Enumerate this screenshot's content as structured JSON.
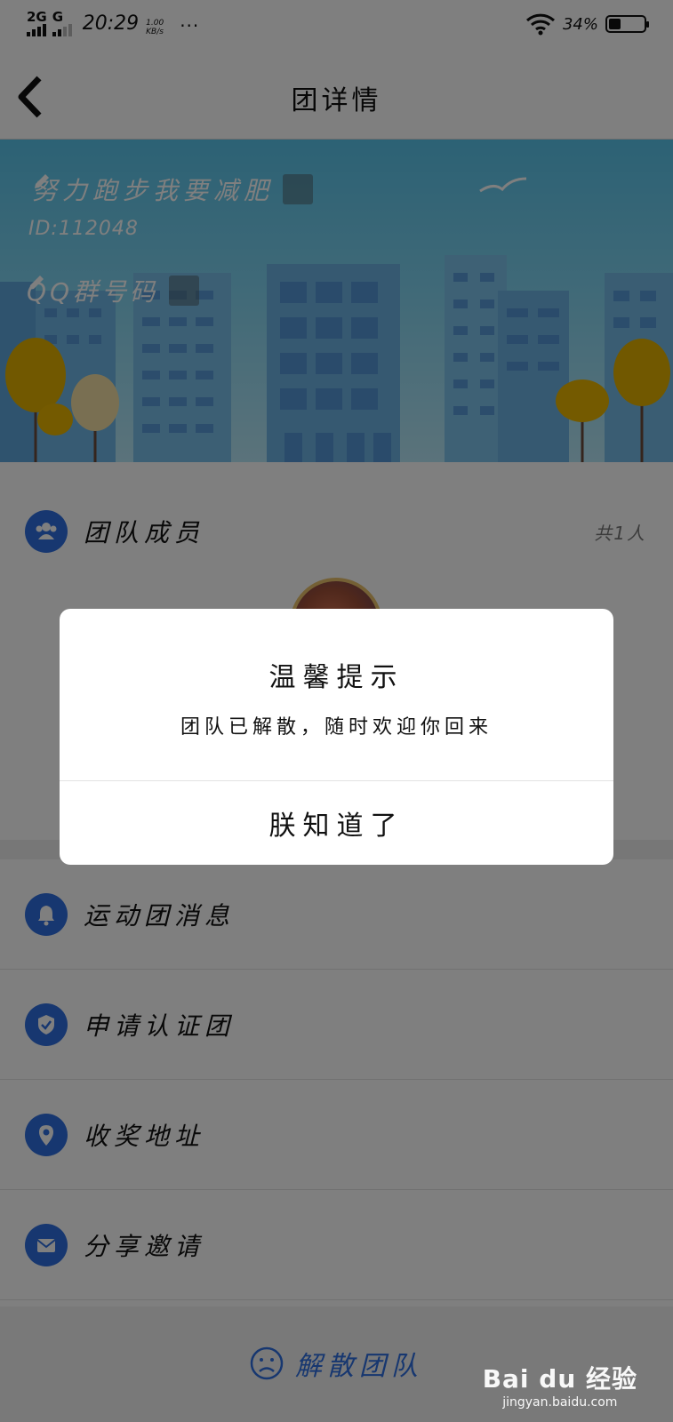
{
  "status_bar": {
    "network1": "2G",
    "network2": "G",
    "time": "20:29",
    "speed_value": "1.00",
    "speed_unit": "KB/s",
    "more": "···",
    "battery_percent": "34%",
    "battery_level": 0.34
  },
  "nav": {
    "title": "团详情",
    "back_icon": "chevron-left-icon"
  },
  "banner": {
    "team_name": "努力跑步我要减肥",
    "team_id": "ID:112048",
    "qq_label": "QQ群号码",
    "edit_icon": "pencil-icon"
  },
  "members": {
    "label": "团队成员",
    "count": "共1人",
    "icon": "group-icon"
  },
  "menu": [
    {
      "label": "运动团消息",
      "icon": "bell-icon"
    },
    {
      "label": "申请认证团",
      "icon": "shield-check-icon"
    },
    {
      "label": "收奖地址",
      "icon": "location-pin-icon"
    },
    {
      "label": "分享邀请",
      "icon": "envelope-icon"
    }
  ],
  "dissolve": {
    "label": "解散团队",
    "icon": "sad-face-icon"
  },
  "dialog": {
    "title": "温馨提示",
    "message": "团队已解散，随时欢迎你回来",
    "button": "朕知道了"
  },
  "watermark": {
    "brand": "Bai du 经验",
    "url": "jingyan.baidu.com"
  },
  "colors": {
    "accent": "#2e6fe0",
    "overlay": "rgba(0,0,0,0.5)"
  }
}
